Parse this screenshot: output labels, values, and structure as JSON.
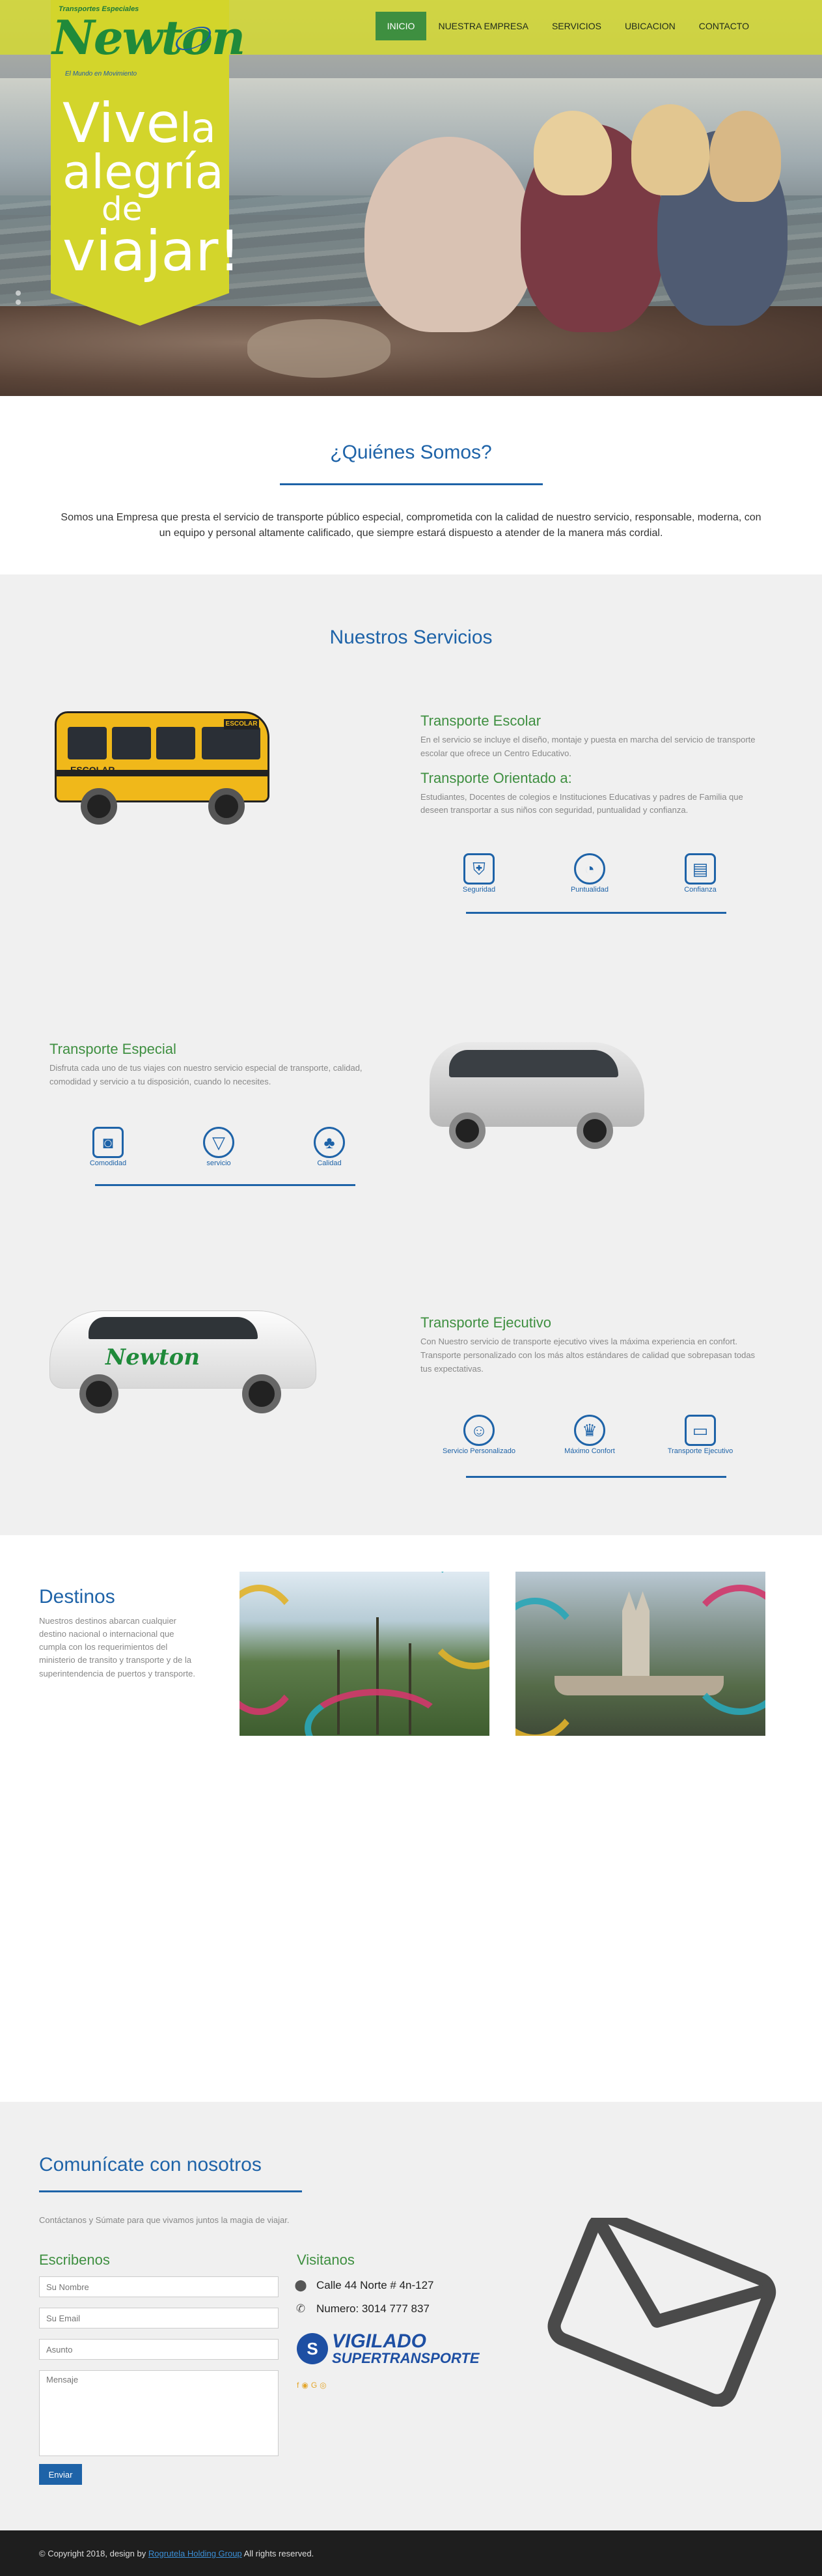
{
  "brand": {
    "logo_word": "Newton",
    "logo_top": "Transportes Especiales",
    "logo_sub": "El Mundo en Movimiento",
    "tagline": {
      "l1a": "Vive",
      "l1b": "la",
      "l2": "alegría",
      "l3": "de",
      "l4": "viajar!"
    }
  },
  "nav": {
    "items": [
      {
        "label": "INICIO",
        "active": true
      },
      {
        "label": "NUESTRA EMPRESA",
        "active": false
      },
      {
        "label": "SERVICIOS",
        "active": false
      },
      {
        "label": "UBICACION",
        "active": false
      },
      {
        "label": "CONTACTO",
        "active": false
      }
    ]
  },
  "quienes": {
    "title": "¿Quiénes Somos?",
    "text": "Somos una Empresa que presta el servicio de transporte público especial, comprometida con la calidad de nuestro servicio, responsable, moderna, con un equipo y personal altamente calificado, que siempre estará dispuesto a atender de la manera más cordial."
  },
  "servicios": {
    "title": "Nuestros Servicios",
    "escolar": {
      "title": "Transporte Escolar",
      "text": "En el servicio se incluye el diseño, montaje y puesta en marcha del servicio de transporte escolar que ofrece un Centro Educativo.",
      "title2": "Transporte Orientado a:",
      "text2": "Estudiantes, Docentes de colegios e Instituciones Educativas y padres de Familia que deseen transportar a sus niños con seguridad, puntualidad y confianza.",
      "bus_sign": "ESCOLAR",
      "bus_side": "ESCOLAR",
      "icons": [
        "Seguridad",
        "Puntualidad",
        "Confianza"
      ]
    },
    "especial": {
      "title": "Transporte Especial",
      "text": "Disfruta cada uno de tus viajes con nuestro servicio especial de transporte, calidad, comodidad y servicio a tu disposición, cuando lo necesites.",
      "icons": [
        "Comodidad",
        "servicio",
        "Calidad"
      ]
    },
    "ejecutivo": {
      "title": "Transporte Ejecutivo",
      "text": "Con Nuestro servicio de transporte ejecutivo vives la máxima experiencia en confort. Transporte personalizado con los más altos estándares de calidad que sobrepasan todas tus expectativas.",
      "car_brand": "Newton",
      "icons": [
        "Servicio Personalizado",
        "Máximo Confort",
        "Transporte Ejecutivo"
      ]
    }
  },
  "destinos": {
    "title": "Destinos",
    "text": "Nuestros destinos abarcan cualquier destino nacional o internacional que cumpla con los requerimientos del ministerio de transito y transporte y de la superintendencia de puertos y transporte."
  },
  "contacto": {
    "title": "Comunícate con nosotros",
    "intro": "Contáctanos y Súmate para que vivamos juntos la magia de viajar.",
    "form_title": "Escribenos",
    "name_placeholder": "Su Nombre",
    "email_placeholder": "Su Email",
    "subject_placeholder": "Asunto",
    "message_placeholder": "Mensaje",
    "send_label": "Enviar",
    "visit_title": "Visitanos",
    "address": "Calle 44 Norte # 4n-127",
    "phone": "Numero: 3014 777 837",
    "vigilado_a": "VIGILADO",
    "vigilado_b": "SUPERTRANSPORTE",
    "vigilado_circle": "S"
  },
  "footer": {
    "prefix": "© Copyright 2018, design by",
    "link": "Rogrutela Holding Group",
    "suffix": "All rights reserved."
  },
  "colors": {
    "accent_green": "#3e8f40",
    "accent_blue": "#1e63a8",
    "brand_yellow": "#d3d52b"
  }
}
